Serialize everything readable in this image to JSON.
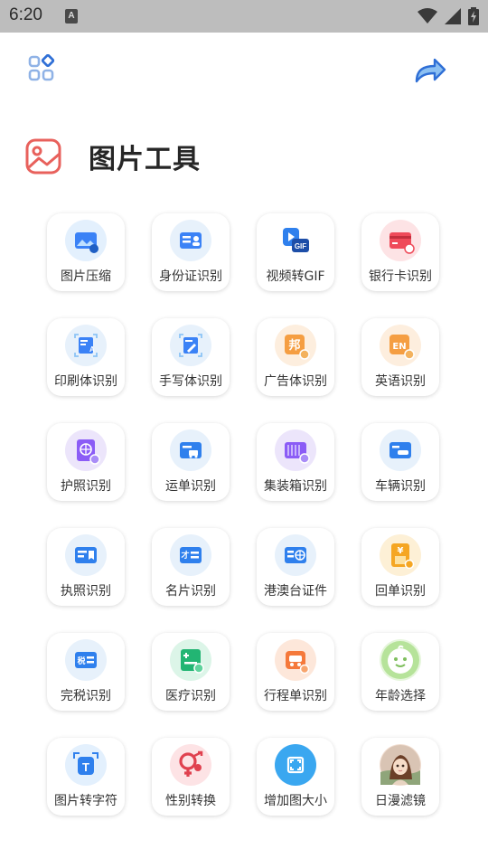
{
  "status_bar": {
    "time": "6:20",
    "notification_letter": "A"
  },
  "header": {
    "title": "图片工具"
  },
  "tools": [
    {
      "label": "图片压缩",
      "icon": "image-compress-icon",
      "color": "#3b82f6",
      "bg": "#e3f0fd"
    },
    {
      "label": "身份证识别",
      "icon": "id-card-icon",
      "color": "#3b82f6",
      "bg": "#e7f1fb"
    },
    {
      "label": "视频转GIF",
      "icon": "video-gif-icon",
      "color": "#2f80ed",
      "bg": "#ffffff"
    },
    {
      "label": "银行卡识别",
      "icon": "bank-card-icon",
      "color": "#ef4b5a",
      "bg": "#fde3e5"
    },
    {
      "label": "印刷体识别",
      "icon": "print-text-icon",
      "color": "#3b82f6",
      "bg": "#e7f1fb"
    },
    {
      "label": "手写体识别",
      "icon": "handwriting-icon",
      "color": "#3b82f6",
      "bg": "#e7f1fb"
    },
    {
      "label": "广告体识别",
      "icon": "ad-text-icon",
      "color": "#f59e42",
      "bg": "#fdeede",
      "glyph": "邦"
    },
    {
      "label": "英语识别",
      "icon": "english-icon",
      "color": "#f59e42",
      "bg": "#fdeede",
      "glyph": "EN"
    },
    {
      "label": "护照识别",
      "icon": "passport-icon",
      "color": "#8b5cf6",
      "bg": "#ece5fb"
    },
    {
      "label": "运单识别",
      "icon": "waybill-icon",
      "color": "#2f80ed",
      "bg": "#e7f1fb"
    },
    {
      "label": "集装箱识别",
      "icon": "container-icon",
      "color": "#8b5cf6",
      "bg": "#ece5fb"
    },
    {
      "label": "车辆识别",
      "icon": "vehicle-icon",
      "color": "#2f80ed",
      "bg": "#e7f1fb"
    },
    {
      "label": "执照识别",
      "icon": "license-icon",
      "color": "#2f80ed",
      "bg": "#e7f1fb"
    },
    {
      "label": "名片识别",
      "icon": "business-card-icon",
      "color": "#2f80ed",
      "bg": "#e7f1fb"
    },
    {
      "label": "港澳台证件",
      "icon": "hk-macao-tw-permit-icon",
      "color": "#2f80ed",
      "bg": "#e7f1fb"
    },
    {
      "label": "回单识别",
      "icon": "receipt-icon",
      "color": "#f5a623",
      "bg": "#fdf0d6",
      "glyph": "¥"
    },
    {
      "label": "完税识别",
      "icon": "tax-icon",
      "color": "#2f80ed",
      "bg": "#e7f1fb",
      "glyph": "税"
    },
    {
      "label": "医疗识别",
      "icon": "medical-icon",
      "color": "#22b573",
      "bg": "#dcf5e8"
    },
    {
      "label": "行程单识别",
      "icon": "itinerary-icon",
      "color": "#f5793b",
      "bg": "#fde7da"
    },
    {
      "label": "年龄选择",
      "icon": "baby-face-icon",
      "color": "#8cd36e",
      "bg": "#e6f6dc"
    },
    {
      "label": "图片转字符",
      "icon": "image-to-text-icon",
      "color": "#2f80ed",
      "bg": "#e3f0fd",
      "glyph": "T"
    },
    {
      "label": "性别转换",
      "icon": "gender-swap-icon",
      "color": "#e0414f",
      "bg": "#fde3e5"
    },
    {
      "label": "增加图大小",
      "icon": "enlarge-image-icon",
      "color": "#3aa7f0",
      "bg": "#3aa7f0"
    },
    {
      "label": "日漫滤镜",
      "icon": "anime-filter-icon",
      "color": "#a36b47",
      "bg": "#f1ddd0"
    }
  ]
}
